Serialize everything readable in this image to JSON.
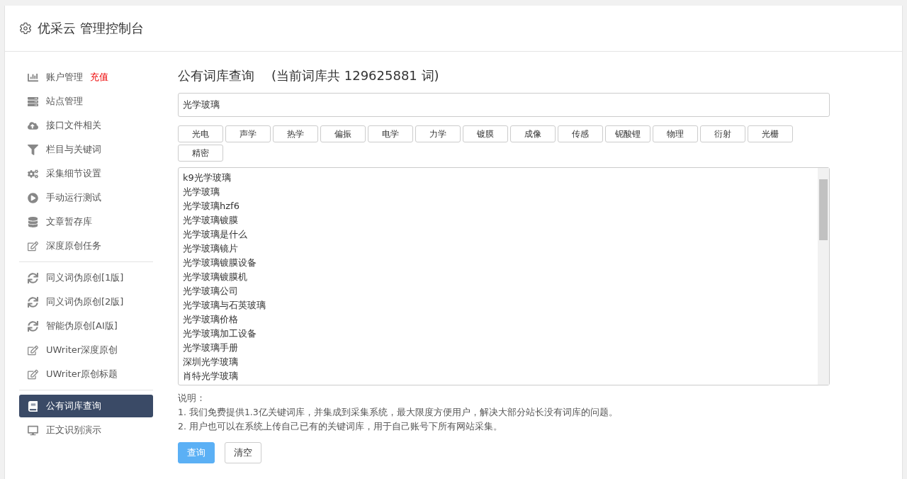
{
  "header": {
    "title": "优采云 管理控制台"
  },
  "sidebar": {
    "groups": [
      {
        "items": [
          {
            "kind": "chart",
            "label": "账户管理",
            "badge": "充值",
            "selected": false
          },
          {
            "kind": "server",
            "label": "站点管理",
            "selected": false
          },
          {
            "kind": "cloud",
            "label": "接口文件相关",
            "selected": false
          },
          {
            "kind": "filter",
            "label": "栏目与关键词",
            "selected": false
          },
          {
            "kind": "gears",
            "label": "采集细节设置",
            "selected": false
          },
          {
            "kind": "play",
            "label": "手动运行测试",
            "selected": false
          },
          {
            "kind": "database",
            "label": "文章暂存库",
            "selected": false
          },
          {
            "kind": "edit",
            "label": "深度原创任务",
            "selected": false
          }
        ]
      },
      {
        "items": [
          {
            "kind": "refresh",
            "label": "同义词伪原创[1版]",
            "selected": false
          },
          {
            "kind": "refresh",
            "label": "同义词伪原创[2版]",
            "selected": false
          },
          {
            "kind": "refresh",
            "label": "智能伪原创[AI版]",
            "selected": false
          },
          {
            "kind": "edit",
            "label": "UWriter深度原创",
            "selected": false
          },
          {
            "kind": "edit",
            "label": "UWriter原创标题",
            "selected": false
          }
        ]
      },
      {
        "items": [
          {
            "kind": "book",
            "label": "公有词库查询",
            "selected": true
          },
          {
            "kind": "monitor",
            "label": "正文识别演示",
            "selected": false
          }
        ]
      }
    ]
  },
  "main": {
    "title": "公有词库查询",
    "count": "(当前词库共 129625881 词)",
    "search": {
      "value": "光学玻璃"
    },
    "tags": [
      "光电",
      "声学",
      "热学",
      "偏振",
      "电学",
      "力学",
      "镀膜",
      "成像",
      "传感",
      "铌酸锂",
      "物理",
      "衍射",
      "光栅",
      "精密"
    ],
    "results": [
      "k9光学玻璃",
      "光学玻璃",
      "光学玻璃hzf6",
      "光学玻璃镀膜",
      "光学玻璃是什么",
      "光学玻璃镜片",
      "光学玻璃镀膜设备",
      "光学玻璃镀膜机",
      "光学玻璃公司",
      "光学玻璃与石英玻璃",
      "光学玻璃价格",
      "光学玻璃加工设备",
      "光学玻璃手册",
      "深圳光学玻璃",
      "肖特光学玻璃"
    ],
    "notes": {
      "title": "说明：",
      "lines": [
        "1. 我们免费提供1.3亿关键词库，并集成到采集系统，最大限度方便用户，解决大部分站长没有词库的问题。",
        "2. 用户也可以在系统上传自己已有的关键词库，用于自己账号下所有网站采集。"
      ]
    },
    "buttons": [
      {
        "kind": "primary",
        "label": "查询"
      },
      {
        "kind": "default",
        "label": "清空"
      }
    ]
  }
}
